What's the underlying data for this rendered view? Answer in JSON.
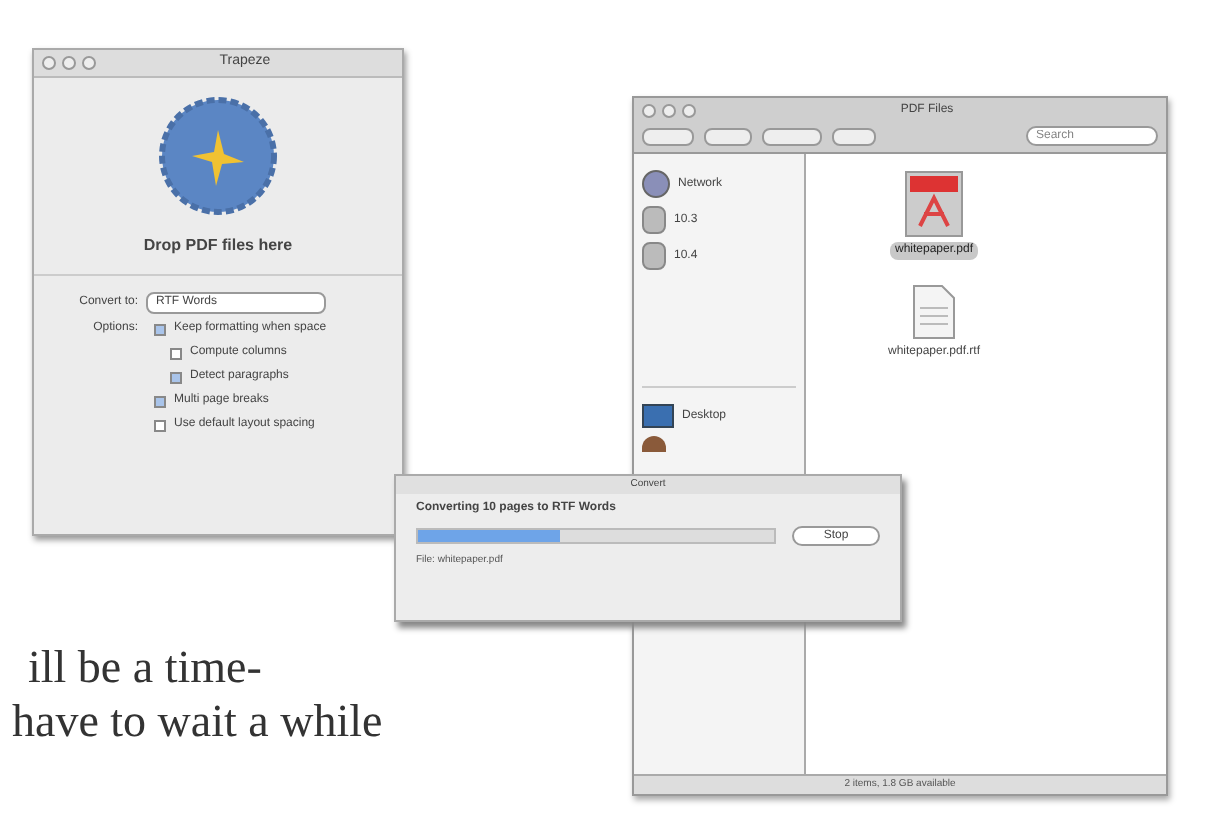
{
  "converter_window": {
    "title": "Trapeze",
    "drop_label": "Drop PDF files here",
    "convert_to_label": "Convert to:",
    "convert_to_value": "RTF Words",
    "options_label": "Options:",
    "options": [
      {
        "label": "Keep formatting when space",
        "checked": true,
        "indented": false
      },
      {
        "label": "Compute columns",
        "checked": false,
        "indented": true
      },
      {
        "label": "Detect paragraphs",
        "checked": true,
        "indented": true
      },
      {
        "label": "Multi page breaks",
        "checked": true,
        "indented": false
      },
      {
        "label": "Use default layout spacing",
        "checked": false,
        "indented": false
      }
    ]
  },
  "finder_window": {
    "title": "PDF Files",
    "search": {
      "placeholder": "Search"
    },
    "sidebar": [
      {
        "label": "Network",
        "kind": "network"
      },
      {
        "label": "10.3",
        "kind": "disk"
      },
      {
        "label": "10.4",
        "kind": "disk"
      },
      {
        "label": "Desktop",
        "kind": "desktop"
      },
      {
        "kind": "home"
      }
    ],
    "files": [
      {
        "name": "whitepaper.pdf",
        "kind": "pdf",
        "selected": true
      },
      {
        "name": "whitepaper.pdf.rtf",
        "kind": "doc",
        "selected": false
      }
    ],
    "status_bar": "2 items, 1.8 GB available"
  },
  "progress_dialog": {
    "title": "Convert",
    "message": "Converting 10 pages to RTF Words",
    "level": 0.4,
    "button": "Stop",
    "file": "File: whitepaper.pdf"
  },
  "body_text": [
    "ill be a time-",
    "have to wait a while"
  ]
}
